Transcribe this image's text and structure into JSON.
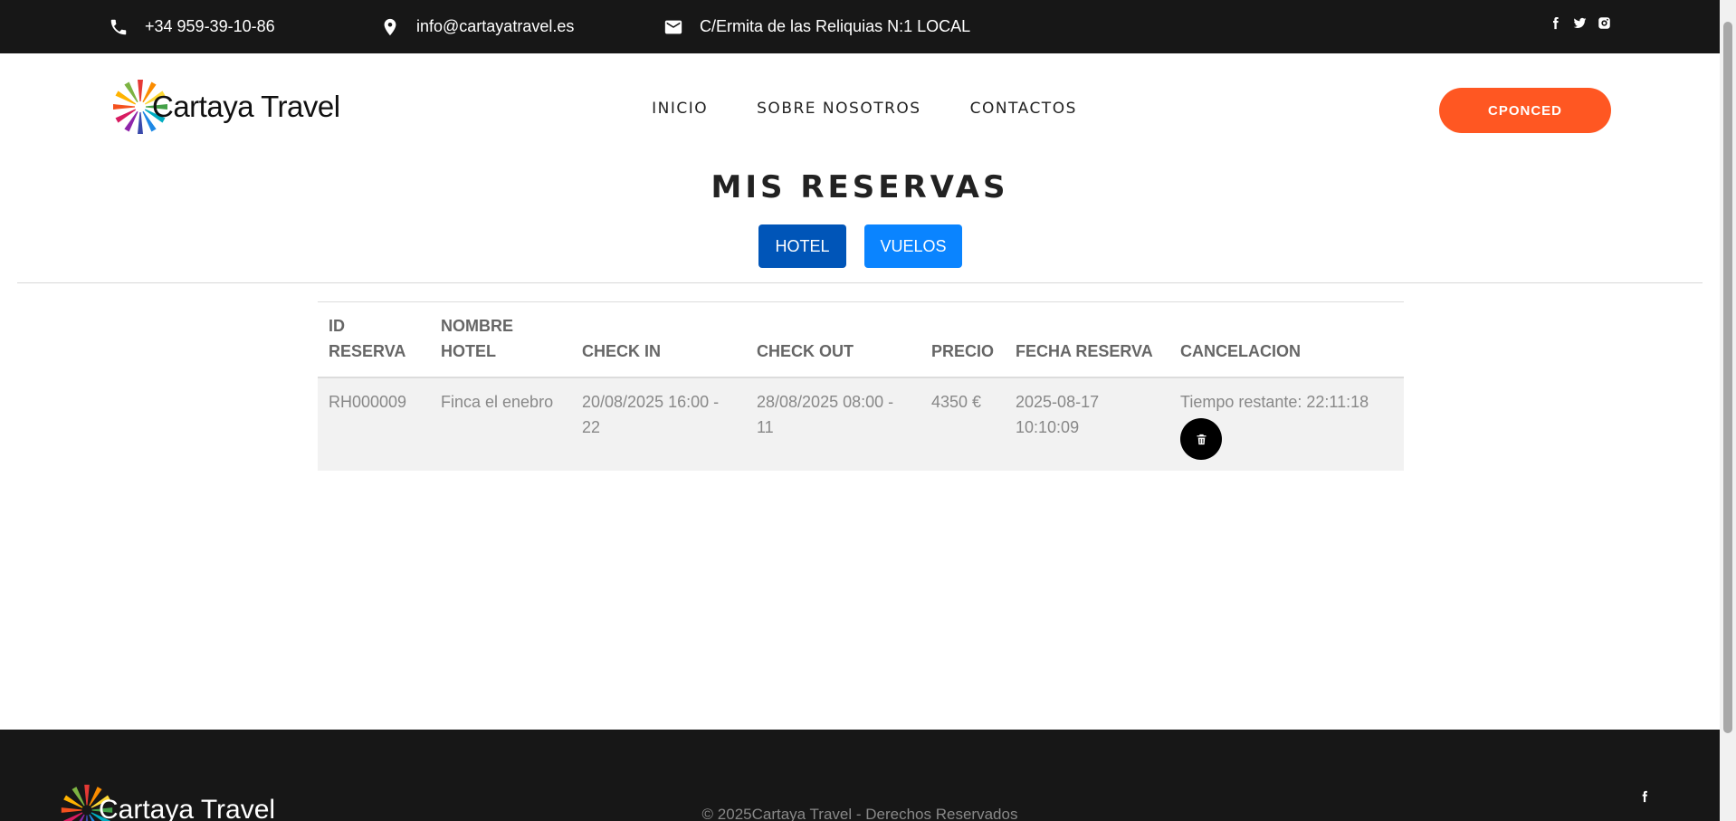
{
  "topbar": {
    "phone": "+34 959-39-10-86",
    "email": "info@cartayatravel.es",
    "address": "C/Ermita de las Reliquias N:1 LOCAL",
    "social": [
      "facebook-icon",
      "twitter-icon",
      "instagram-icon"
    ]
  },
  "header": {
    "brand": "Cartaya Travel",
    "nav": [
      "INICIO",
      "SOBRE NOSOTROS",
      "CONTACTOS"
    ],
    "user_button": "CPONCED"
  },
  "main": {
    "title": "MIS RESERVAS",
    "tabs": [
      "HOTEL",
      "VUELOS"
    ],
    "table": {
      "headers": [
        "ID RESERVA",
        "NOMBRE HOTEL",
        "CHECK IN",
        "CHECK OUT",
        "PRECIO",
        "FECHA RESERVA",
        "CANCELACION"
      ],
      "rows": [
        {
          "id": "RH000009",
          "hotel": "Finca el enebro",
          "check_in": "20/08/2025 16:00 - 22",
          "check_out": "28/08/2025 08:00 - 11",
          "precio": "4350 €",
          "fecha_reserva": "2025-08-17 10:10:09",
          "cancelacion": "Tiempo restante: 22:11:18"
        }
      ]
    }
  },
  "footer": {
    "brand": "Cartaya Travel",
    "copyright": "© 2025Cartaya Travel - Derechos Reservados"
  },
  "colors": {
    "topbar_bg": "#171717",
    "accent_orange": "#ff5722",
    "hotel_tab": "#0055b8",
    "vuelos_tab": "#0a84ff"
  }
}
